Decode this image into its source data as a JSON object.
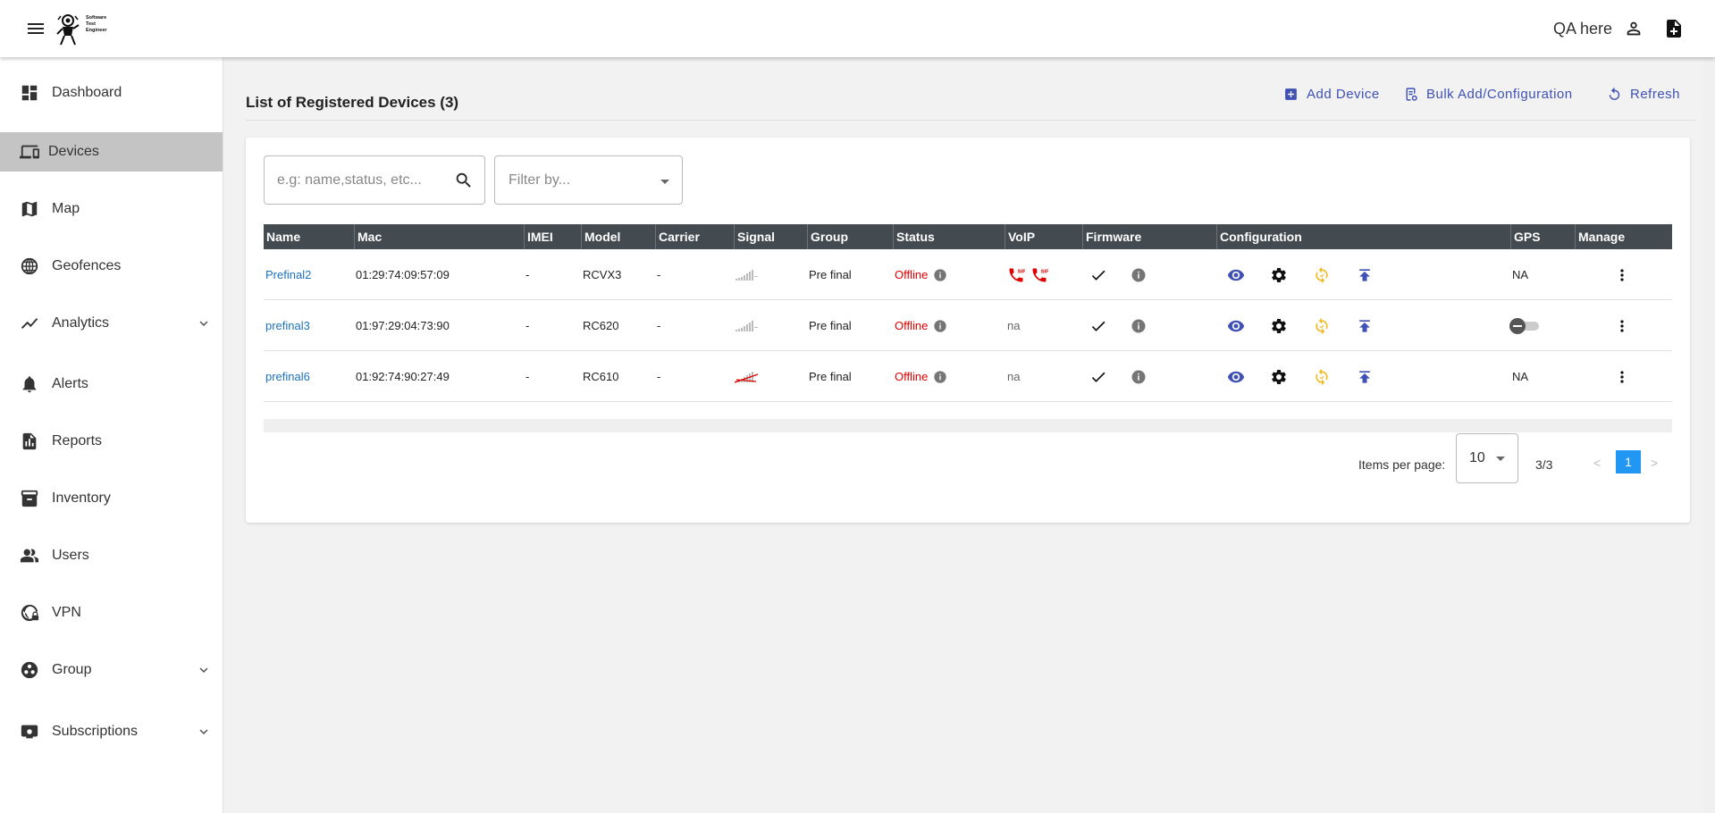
{
  "header": {
    "logo_lines": [
      "Software",
      "Test",
      "Engineer"
    ],
    "user_name": "QA here"
  },
  "sidebar": {
    "items": [
      {
        "label": "Dashboard",
        "icon": "dashboard-icon"
      },
      {
        "label": "Devices",
        "icon": "devices-icon",
        "active": true
      },
      {
        "label": "Map",
        "icon": "map-icon"
      },
      {
        "label": "Geofences",
        "icon": "globe-grid-icon"
      },
      {
        "label": "Analytics",
        "icon": "analytics-icon",
        "expandable": true
      },
      {
        "label": "Alerts",
        "icon": "bell-icon"
      },
      {
        "label": "Reports",
        "icon": "report-icon"
      },
      {
        "label": "Inventory",
        "icon": "inventory-icon"
      },
      {
        "label": "Users",
        "icon": "users-icon"
      },
      {
        "label": "VPN",
        "icon": "vpn-icon"
      },
      {
        "label": "Group",
        "icon": "group-icon",
        "expandable": true
      },
      {
        "label": "Subscriptions",
        "icon": "subscriptions-icon",
        "expandable": true
      }
    ]
  },
  "main": {
    "title": "List of Registered Devices (3)",
    "actions": {
      "add_device": "Add Device",
      "bulk_add": "Bulk Add/Configuration",
      "refresh": "Refresh"
    },
    "search_placeholder": "e.g: name,status, etc...",
    "filter_placeholder": "Filter by...",
    "columns": [
      "Name",
      "Mac",
      "IMEI",
      "Model",
      "Carrier",
      "Signal",
      "Group",
      "Status",
      "VoIP",
      "Firmware",
      "Configuration",
      "GPS",
      "Manage"
    ],
    "rows": [
      {
        "name": "Prefinal2",
        "mac": "01:29:74:09:57:09",
        "imei": "-",
        "model": "RCVX3",
        "carrier": "-",
        "signal": "no-signal",
        "group": "Pre final",
        "status": "Offline",
        "voip": "sip-icons",
        "gps": "NA"
      },
      {
        "name": "prefinal3",
        "mac": "01:97:29:04:73:90",
        "imei": "-",
        "model": "RC620",
        "carrier": "-",
        "signal": "no-signal",
        "group": "Pre final",
        "status": "Offline",
        "voip": "na",
        "gps": "toggle-off"
      },
      {
        "name": "prefinal6",
        "mac": "01:92:74:90:27:49",
        "imei": "-",
        "model": "RC610",
        "carrier": "-",
        "signal": "signal-crossed",
        "group": "Pre final",
        "status": "Offline",
        "voip": "na",
        "gps": "NA"
      }
    ],
    "pagination": {
      "items_per_page_label": "Items per page:",
      "items_per_page": "10",
      "range": "3/3",
      "prev": "<",
      "page": "1",
      "next": ">"
    }
  },
  "colors": {
    "accent": "#3f51b5",
    "link": "#1e73be",
    "offline": "#e00000",
    "table_header": "#434a50",
    "sync": "#f5b921",
    "page_active": "#2196f3"
  }
}
